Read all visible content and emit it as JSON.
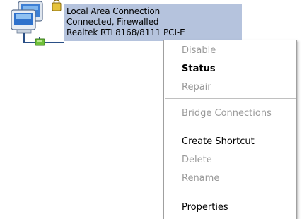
{
  "connection": {
    "name": "Local Area Connection",
    "status": "Connected, Firewalled",
    "adapter": "Realtek RTL8168/8111 PCI-E",
    "icon": "network-connection-icon",
    "selection_color": "#b5c3dd"
  },
  "context_menu": {
    "items": [
      {
        "label": "Disable",
        "enabled": false,
        "default": false
      },
      {
        "label": "Status",
        "enabled": true,
        "default": true
      },
      {
        "label": "Repair",
        "enabled": false,
        "default": false
      },
      {
        "label": "Bridge Connections",
        "enabled": false,
        "default": false
      },
      {
        "label": "Create Shortcut",
        "enabled": true,
        "default": false
      },
      {
        "label": "Delete",
        "enabled": false,
        "default": false
      },
      {
        "label": "Rename",
        "enabled": false,
        "default": false
      },
      {
        "label": "Properties",
        "enabled": true,
        "default": false
      }
    ]
  }
}
